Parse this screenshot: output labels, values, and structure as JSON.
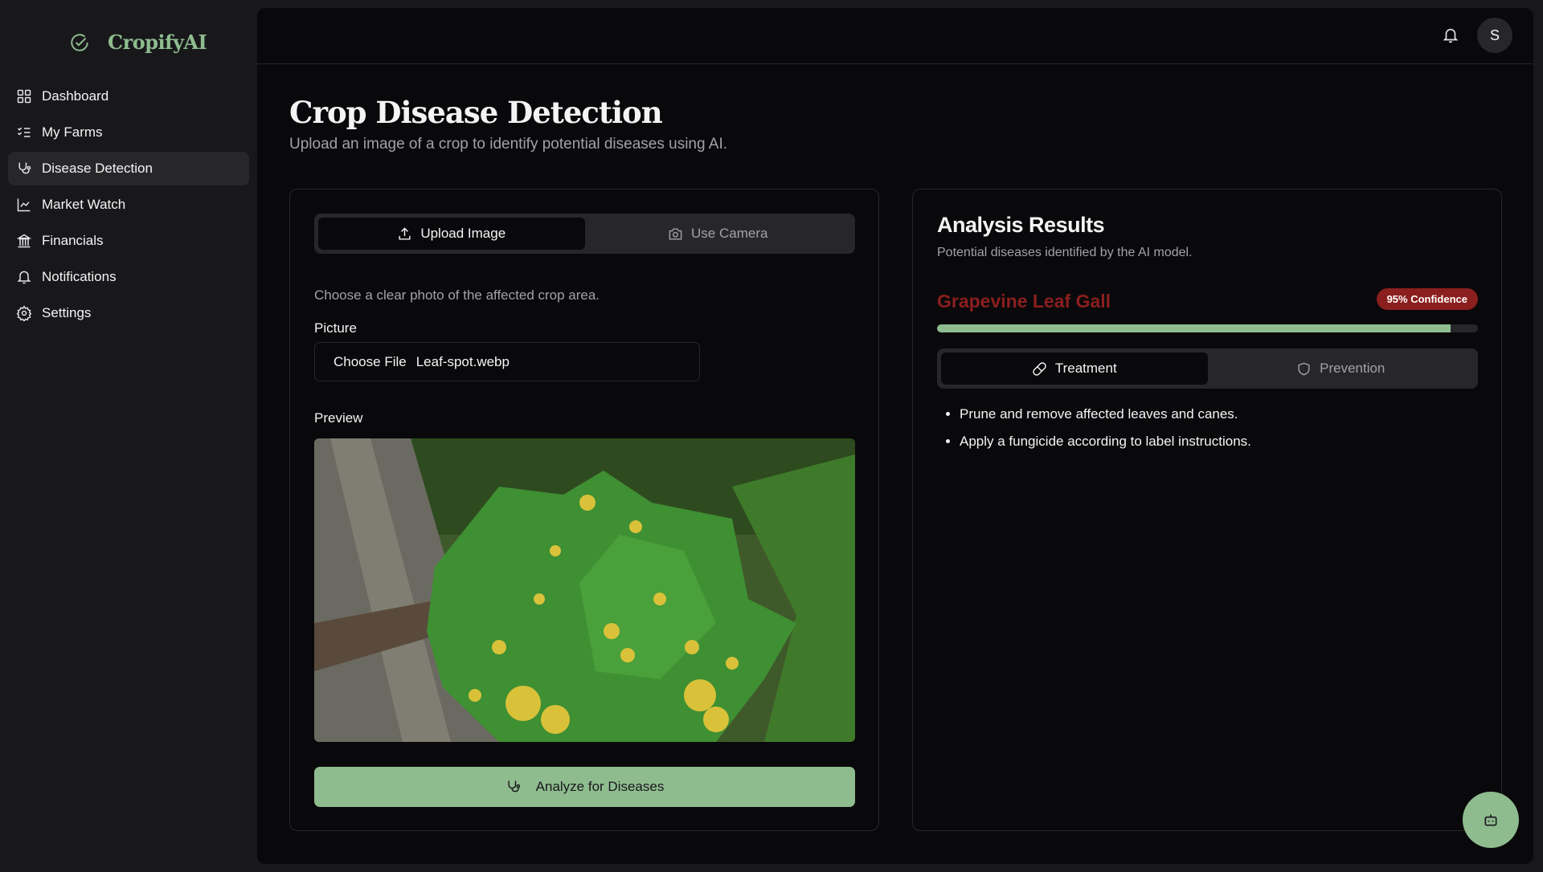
{
  "app": {
    "name": "CropifyAI",
    "brand_color": "#8fbc8f"
  },
  "sidebar": {
    "items": [
      {
        "label": "Dashboard",
        "icon": "grid-icon"
      },
      {
        "label": "My Farms",
        "icon": "list-check-icon"
      },
      {
        "label": "Disease Detection",
        "icon": "stethoscope-icon",
        "active": true
      },
      {
        "label": "Market Watch",
        "icon": "chart-icon"
      },
      {
        "label": "Financials",
        "icon": "bank-icon"
      },
      {
        "label": "Notifications",
        "icon": "bell-icon"
      },
      {
        "label": "Settings",
        "icon": "gear-icon"
      }
    ]
  },
  "header": {
    "avatar_initial": "S"
  },
  "page": {
    "title": "Crop Disease Detection",
    "subtitle": "Upload an image of a crop to identify potential diseases using AI."
  },
  "upload": {
    "tabs": [
      {
        "label": "Upload Image",
        "active": true
      },
      {
        "label": "Use Camera"
      }
    ],
    "hint": "Choose a clear photo of the affected crop area.",
    "picture_label": "Picture",
    "choose_file": "Choose File",
    "file_name": "Leaf-spot.webp",
    "preview_label": "Preview",
    "analyze_label": "Analyze for Diseases"
  },
  "results": {
    "title": "Analysis Results",
    "subtitle": "Potential diseases identified by the AI model.",
    "disease": "Grapevine Leaf Gall",
    "disease_color": "#8b1e1e",
    "confidence_label": "95% Confidence",
    "confidence": 95,
    "tabs": [
      {
        "label": "Treatment",
        "active": true
      },
      {
        "label": "Prevention"
      }
    ],
    "treatment": [
      "Prune and remove affected leaves and canes.",
      "Apply a fungicide according to label instructions."
    ]
  }
}
